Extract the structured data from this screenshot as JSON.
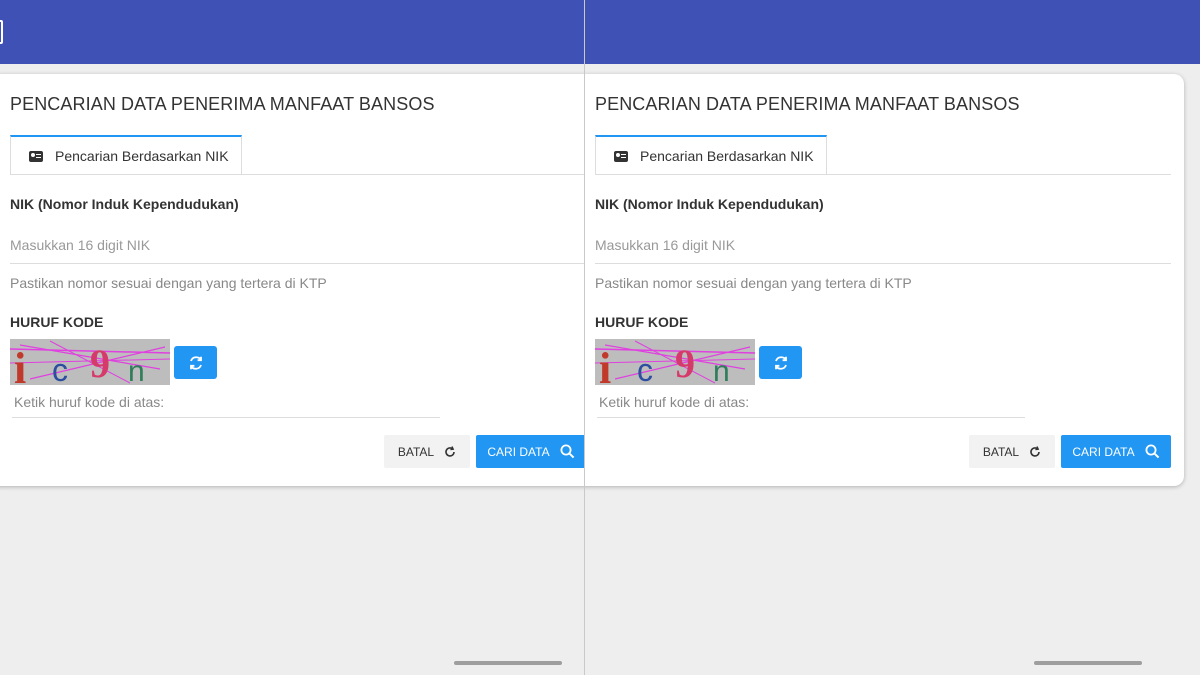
{
  "panes": [
    {
      "title": "PENCARIAN DATA PENERIMA MANFAAT BANSOS",
      "tab_label": "Pencarian Berdasarkan NIK",
      "nik_label": "NIK (Nomor Induk Kependudukan)",
      "nik_placeholder": "Masukkan 16 digit NIK",
      "nik_hint": "Pastikan nomor sesuai dengan yang tertera di KTP",
      "captcha_label": "HURUF KODE",
      "captcha_text": "ic9n",
      "captcha_placeholder": "Ketik huruf kode di atas:",
      "cancel_label": "BATAL",
      "search_label": "CARI DATA"
    },
    {
      "title": "PENCARIAN DATA PENERIMA MANFAAT BANSOS",
      "tab_label": "Pencarian Berdasarkan NIK",
      "nik_label": "NIK (Nomor Induk Kependudukan)",
      "nik_placeholder": "Masukkan 16 digit NIK",
      "nik_hint": "Pastikan nomor sesuai dengan yang tertera di KTP",
      "captcha_label": "HURUF KODE",
      "captcha_text": "ic9n",
      "captcha_placeholder": "Ketik huruf kode di atas:",
      "cancel_label": "BATAL",
      "search_label": "CARI DATA"
    }
  ],
  "colors": {
    "appbar": "#3f51b5",
    "accent": "#2196f3",
    "background": "#eeeeee"
  },
  "icons": [
    "menu-icon",
    "id-card-icon",
    "refresh-icon",
    "reload-icon",
    "search-icon"
  ]
}
